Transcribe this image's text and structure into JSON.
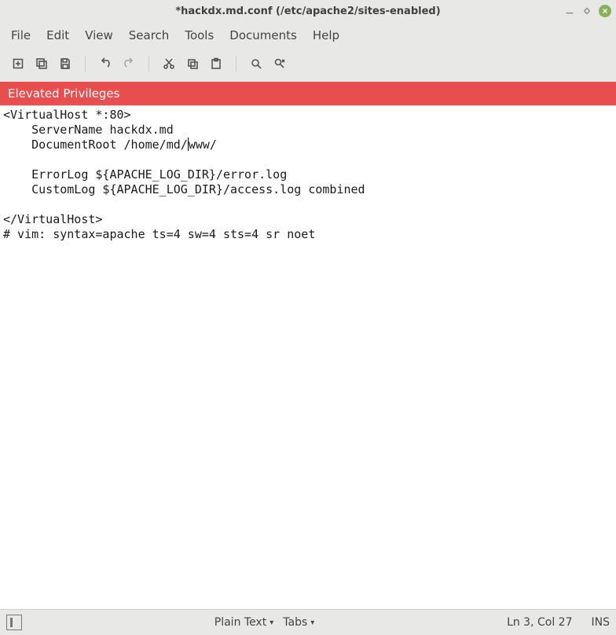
{
  "titlebar": {
    "title": "*hackdx.md.conf (/etc/apache2/sites-enabled)"
  },
  "menubar": {
    "items": [
      "File",
      "Edit",
      "View",
      "Search",
      "Tools",
      "Documents",
      "Help"
    ]
  },
  "banner": {
    "text": "Elevated Privileges"
  },
  "editor": {
    "lines": [
      "<VirtualHost *:80>",
      "    ServerName hackdx.md",
      "    DocumentRoot /home/md/",
      "www/",
      "",
      "    ErrorLog ${APACHE_LOG_DIR}/error.log",
      "    CustomLog ${APACHE_LOG_DIR}/access.log combined",
      "",
      "</VirtualHost>",
      "# vim: syntax=apache ts=4 sw=4 sts=4 sr noet"
    ],
    "cursor_line_index": 2
  },
  "statusbar": {
    "syntax": "Plain Text",
    "indent": "Tabs",
    "position": "Ln 3, Col 27",
    "mode": "INS"
  }
}
